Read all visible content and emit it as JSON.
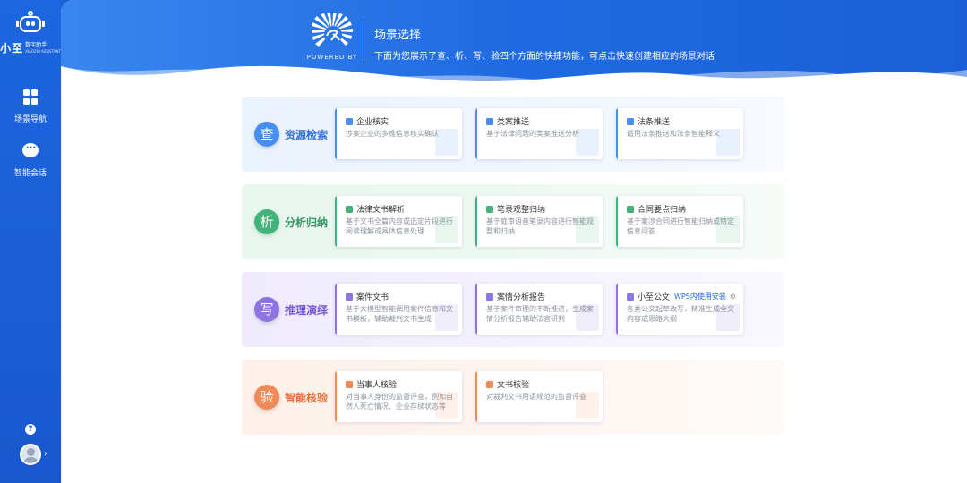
{
  "sidebar": {
    "logo_main": "小至",
    "logo_sub": "数字助手",
    "logo_en": "XIAOZHI ASSISTANT",
    "items": [
      {
        "label": "场景导航",
        "icon": "grid-icon"
      },
      {
        "label": "智能会话",
        "icon": "chat-icon"
      }
    ],
    "help_glyph": "?",
    "chevron": "›"
  },
  "banner": {
    "powered_by": "POWERED BY",
    "title": "场景选择",
    "description": "下面为您展示了查、析、写、验四个方面的快捷功能，可点击快速创建相应的场景对话"
  },
  "colors": {
    "brand_blue": "#1d66e0",
    "row_blue": "#4a8df0",
    "row_green": "#43b37c",
    "row_purple": "#8f73e3",
    "row_orange": "#f08a56"
  },
  "rows": [
    {
      "glyph": "查",
      "title": "资源检索",
      "cards": [
        {
          "title": "企业核实",
          "desc": "涉案企业的多维信息核实确认"
        },
        {
          "title": "类案推送",
          "desc": "基于法律问题的类案推送分析"
        },
        {
          "title": "法条推送",
          "desc": "适用法条推送和法条智能释义"
        }
      ]
    },
    {
      "glyph": "析",
      "title": "分析归纳",
      "cards": [
        {
          "title": "法律文书解析",
          "desc": "基于文书全篇内容或选定片段进行阅读理解或具体信息处理"
        },
        {
          "title": "笔录观整归纳",
          "desc": "基于庭审语音笔录内容进行智能观整和归纳"
        },
        {
          "title": "合同要点归纳",
          "desc": "基于案涉合同进行智能归纳或特定信息问答"
        }
      ]
    },
    {
      "glyph": "写",
      "title": "推理演绎",
      "cards": [
        {
          "title": "案件文书",
          "desc": "基于大模型智能调用案件信息和文书模板，辅助裁判文书生成"
        },
        {
          "title": "案情分析报告",
          "desc": "基于案件审理的不断推进，生成案情分析报告辅助法官研判"
        },
        {
          "title": "小至公文",
          "desc": "各类公文起草改写，精准生成全文内容或思路大纲",
          "extra": "WPS内使用安装",
          "gear": "⚙"
        }
      ]
    },
    {
      "glyph": "验",
      "title": "智能核验",
      "cards": [
        {
          "title": "当事人核验",
          "desc": "对当事人身份的监督评查，例如自然人死亡情况、企业存续状态等"
        },
        {
          "title": "文书核验",
          "desc": "对裁判文书用语规范的监督评查"
        }
      ]
    }
  ]
}
